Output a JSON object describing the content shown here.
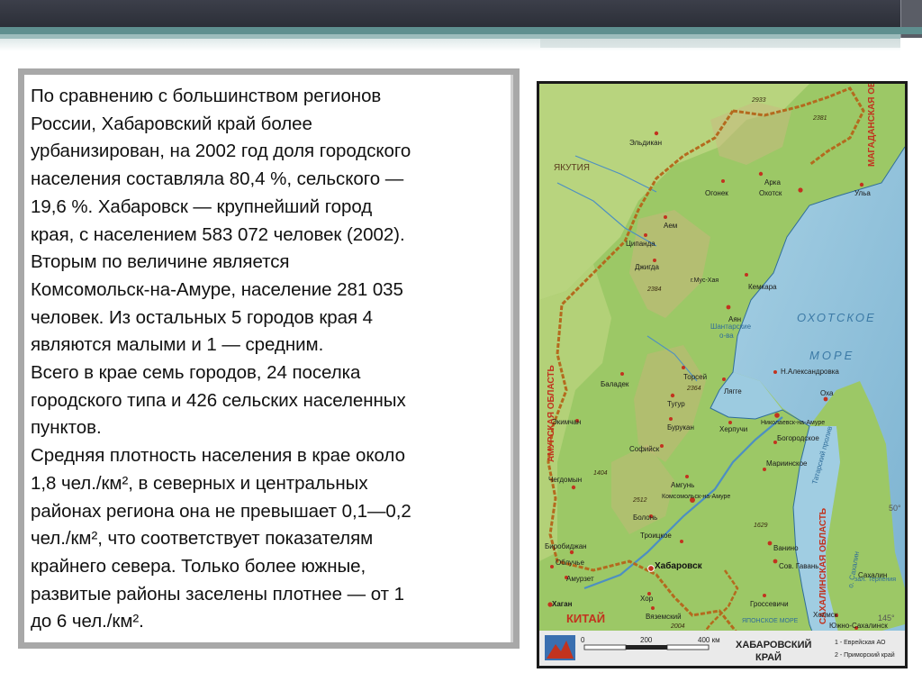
{
  "paragraph_lines": [
    "По сравнению с большинством регионов",
    "России, Хабаровский край более",
    "урбанизирован, на 2002 год доля городского",
    "населения составляла 80,4 %, сельского —",
    "19,6 %. Хабаровск — крупнейший город",
    "края, с населением 583 072 человек (2002).",
    "Вторым по величине является",
    "Комсомольск-на-Амуре, население 281 035",
    "человек. Из остальных 5 городов края 4",
    "являются малыми и 1 — средним.",
    "Всего в крае семь городов, 24 поселка",
    "городского типа и 426 сельских населенных",
    "пунктов.",
    "Средняя плотность населения в крае около",
    "1,8 чел./км², в северных и центральных",
    "районах региона она не превышает 0,1—0,2",
    "чел./км², что соответствует показателям",
    "крайнего севера. Только более южные,",
    "развитые районы заселены плотнее — от 1",
    "до 6 чел./км²."
  ],
  "map": {
    "sea_okhotsk_1": "ОХОТСКОЕ",
    "sea_okhotsk_2": "МОРЕ",
    "region_yakutia": "ЯКУТИЯ",
    "region_magadan": "МАГАДАНСКАЯ ОБЛАСТЬ",
    "region_amur": "АМУРСКАЯ ОБЛАСТЬ",
    "region_sakhalin": "САХАЛИНСКАЯ ОБЛАСТЬ",
    "region_china": "КИТАЙ",
    "region_japan_sea": "ЯПОНСКОЕ МОРЕ",
    "shantar_1": "Шантарские",
    "shantar_2": "о-ва",
    "tatar_strait": "Татарский пролив",
    "sakhalin_island": "о. Сахалин",
    "terpeniya_bay": "зал. Терпения",
    "towns": {
      "eldikan": "Эльдикан",
      "arka": "Арка",
      "okhotsk": "Охотск",
      "ulya": "Ульа",
      "ogonek": "Огонек",
      "ayem": "Аем",
      "tsipanda": "Ципанда",
      "dzhigda": "Джигда",
      "kemkara": "Кемкара",
      "ayan": "Аян",
      "n_alexandrovka": "Н.Александровка",
      "baladek": "Баладек",
      "torsei": "Торсей",
      "tugur": "Тугур",
      "chumikan": "Чумикан",
      "lagge": "Лягге",
      "ekimchan": "Экимчан",
      "burukan": "Бурукан",
      "kherpuchi": "Херпучи",
      "nikolaevsk": "Николаевск-на-Амуре",
      "okha": "Оха",
      "bogorodskoe": "Богородское",
      "sofiysk": "Софийск",
      "amgun": "Амгунь",
      "marinskoe": "Мариинское",
      "chegdomyn": "Чегдомын",
      "komsomolsk": "Комсомольск-на-Амуре",
      "bolon": "Болонь",
      "troitskoe": "Троицкое",
      "vanino": "Ванино",
      "sovgavan": "Сов. Гавань",
      "sakhalin_town": "Сахалин",
      "birobidzhan": "Биробиджан",
      "obluchye": "Облучье",
      "amurzet": "Амурзет",
      "khabarovsk": "Хабаровск",
      "khor": "Хор",
      "vyazemsky": "Вяземский",
      "hagan": "Хаган",
      "grossevichi": "Гроссевичи",
      "kholmsk": "Холмск",
      "yuzhno": "Южно-Сахалинск",
      "peak_yyu": "г.Мус-Хая"
    },
    "elevations": [
      "2381",
      "2933",
      "2384",
      "2364",
      "1404",
      "2512",
      "1629",
      "2004"
    ],
    "lat_50": "50°",
    "lon_145": "145°",
    "scale_ticks": [
      "0",
      "200",
      "400 км"
    ],
    "legend_title_1": "ХАБАРОВСКИЙ",
    "legend_title_2": "КРАЙ",
    "legend_note_1": "1 - Еврейская АО",
    "legend_note_2": "2 - Приморский край"
  },
  "colors": {
    "land_green": "#8cbf5a",
    "land_light": "#b7d57a",
    "mountain_tan": "#c9b77c",
    "sea": "#9cc8de",
    "deep_sea": "#7fb6d4",
    "border": "#b46a1e",
    "text_frame": "#a8a8a8"
  }
}
